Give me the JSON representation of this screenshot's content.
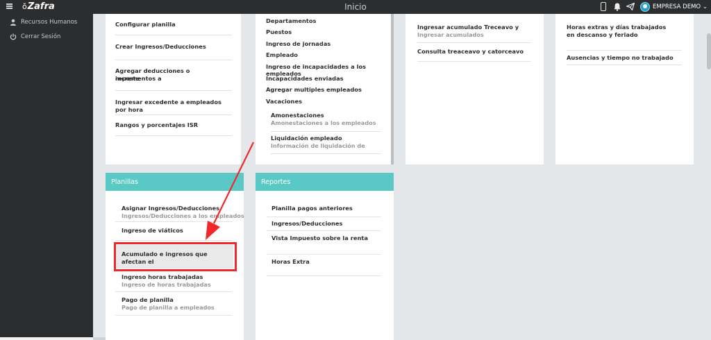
{
  "topbar": {
    "brand": "Zafra",
    "title": "Inicio",
    "company": "EMPRESA DEMO ⌄",
    "icons": [
      "menu-icon",
      "phone-icon",
      "bell-icon",
      "send-icon",
      "avatar"
    ]
  },
  "sidebar": {
    "items": [
      {
        "label": "Recursos Humanos",
        "icon": "user-icon"
      },
      {
        "label": "Cerrar Sesión",
        "icon": "power-icon"
      }
    ]
  },
  "card1": {
    "items": [
      "Configurar planilla",
      "Crear Ingresos/Deducciones",
      "Agregar deducciones o incrementos a",
      "reporte",
      "Ingresar excedente a empleados por hora",
      "Rangos y porcentajes ISR"
    ]
  },
  "card2": {
    "items": [
      "Departamentos",
      "Puestos",
      "Ingreso de jornadas",
      "Empleado",
      "Ingreso de incapacidades a los empleados",
      "Incapacidades enviadas",
      "Agregar multiples empleados",
      "Vacaciones"
    ],
    "sub": [
      {
        "title": "Amonestaciones",
        "subtitle": "Amonestaciones a los empleados"
      },
      {
        "title": "Liquidación empleado",
        "subtitle": "Información de liquidación de"
      }
    ]
  },
  "card3": {
    "items": [
      {
        "title": "Ingresar acumulado Treceavo y",
        "subtitle": "Ingresar acumulados"
      },
      {
        "title": "Consulta treaceavo y catorceavo",
        "subtitle": ""
      }
    ]
  },
  "card4": {
    "items": [
      {
        "line1": "Horas extras y días trabajados",
        "line2": "en descanso y feriado"
      },
      {
        "line1": "Ausencias y tiempo no trabajado",
        "line2": ""
      }
    ]
  },
  "planillas": {
    "header": "Planillas",
    "items": [
      {
        "title": "Asignar Ingresos/Deducciones",
        "subtitle": "Ingresos/Deducciones a los empleados"
      },
      {
        "title": "Ingreso de viáticos",
        "subtitle": ""
      },
      {
        "title": "Acumulado e ingresos que afectan el",
        "subtitle": ""
      },
      {
        "title": "Ingreso horas trabajadas",
        "subtitle": "Ingreso de horas trabajadas"
      },
      {
        "title": "Pago de planilla",
        "subtitle": "Pago de planilla a empleados"
      }
    ]
  },
  "reportes": {
    "header": "Reportes",
    "items": [
      "Planilla pagos anteriores",
      "Ingresos/Deducciones",
      "Vista Impuesto sobre la renta",
      "Horas Extra"
    ]
  },
  "colors": {
    "accent": "#5ac8c5",
    "annotation": "#f0282b",
    "sidebar": "#2b2d2f"
  }
}
